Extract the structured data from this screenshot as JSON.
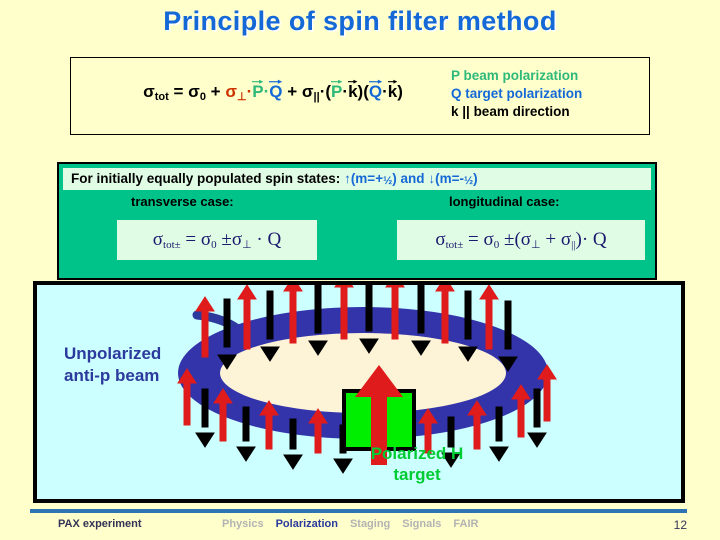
{
  "slide": {
    "title": "Principle of spin filter method",
    "page_number": "12",
    "background_color": "#ffffcc"
  },
  "formula": {
    "lhs": "σ",
    "lhs_sub": "tot",
    "eq": "=",
    "sigma0": "σ",
    "sigma0_sub": "0",
    "plus1": "+",
    "sigma_perp": "σ",
    "sigma_perp_sub": "⊥",
    "dot1": "·",
    "p": "P",
    "dot2": "·",
    "q": "Q",
    "plus2": "+",
    "sigma_par": "σ",
    "sigma_par_sub": "||",
    "dot3": "·",
    "open1": "(",
    "p2": "P",
    "dot4": "·",
    "k1": "k",
    "close1": ")",
    "open2": "(",
    "q2": "Q",
    "dot5": "·",
    "k2": "k",
    "close2": ")",
    "colors": {
      "perp": "#cc3300",
      "p": "#2eb87a",
      "q": "#1569d6"
    }
  },
  "legend": {
    "p_line": "P beam polarization",
    "q_line": "Q target polarization",
    "k_line": "k || beam direction"
  },
  "spin_states": {
    "prefix": "For initially equally populated spin states:",
    "up_arrow": "↑",
    "up_text_open": "(m=+",
    "up_frac": "½",
    "up_text_close": ")",
    "and": "and",
    "down_arrow": "↓",
    "down_text_open": "(m=-",
    "down_frac": "½",
    "down_text_close": ")"
  },
  "cases": {
    "transverse_label": "transverse case:",
    "longitudinal_label": "longitudinal case:",
    "transverse_equation": {
      "lhs": "σ",
      "lhs_sub": "tot±",
      "eq": "=",
      "s0": "σ",
      "s0_sub": "0",
      "pm": "±",
      "sperp": "σ",
      "sperp_sub": "⊥",
      "dot": "·",
      "q": "Q"
    },
    "longitudinal_equation": {
      "lhs": "σ",
      "lhs_sub": "tot±",
      "eq": "=",
      "s0": "σ",
      "s0_sub": "0",
      "pm": "±",
      "open": "(",
      "sperp": "σ",
      "sperp_sub": "⊥",
      "plus": "+",
      "spar": "σ",
      "spar_sub": "||",
      "close": ")",
      "dot": "·",
      "q": "Q"
    }
  },
  "diagram": {
    "beam_label_line1": "Unpolarized",
    "beam_label_line2": "anti-p beam",
    "target_label_line1": "Polarized H",
    "target_label_line2": "target",
    "ring_color": "#3333aa",
    "ring_inner_color": "#fdf3d7",
    "up_arrow_color": "#e01b1b",
    "down_arrow_color": "#000000",
    "target_box_color": "#00ee00",
    "beam_arrow_color": "#2b3a9c",
    "panel_background": "#ccffff",
    "up_arrow_count": 14,
    "down_arrow_count": 14
  },
  "footer": {
    "left_label": "PAX experiment",
    "nav": [
      {
        "label": "Physics",
        "active": false
      },
      {
        "label": "Polarization",
        "active": true
      },
      {
        "label": "Staging",
        "active": false
      },
      {
        "label": "Signals",
        "active": false
      },
      {
        "label": "FAIR",
        "active": false
      }
    ]
  }
}
